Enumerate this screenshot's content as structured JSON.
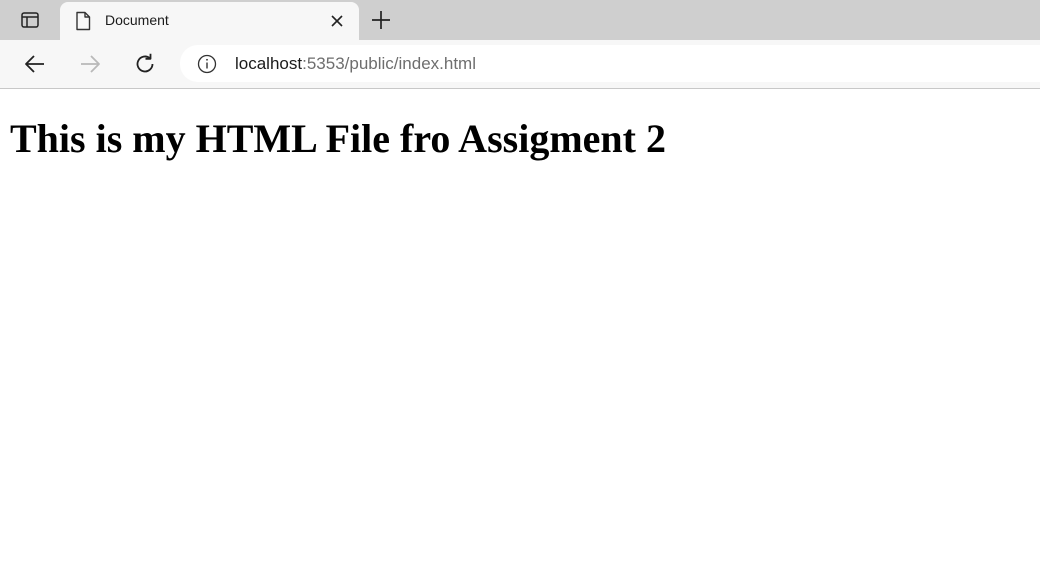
{
  "browser": {
    "tab": {
      "title": "Document"
    },
    "address_bar": {
      "host": "localhost",
      "rest": ":5353/public/index.html"
    }
  },
  "page": {
    "heading": "This is my HTML File fro Assigment 2"
  }
}
